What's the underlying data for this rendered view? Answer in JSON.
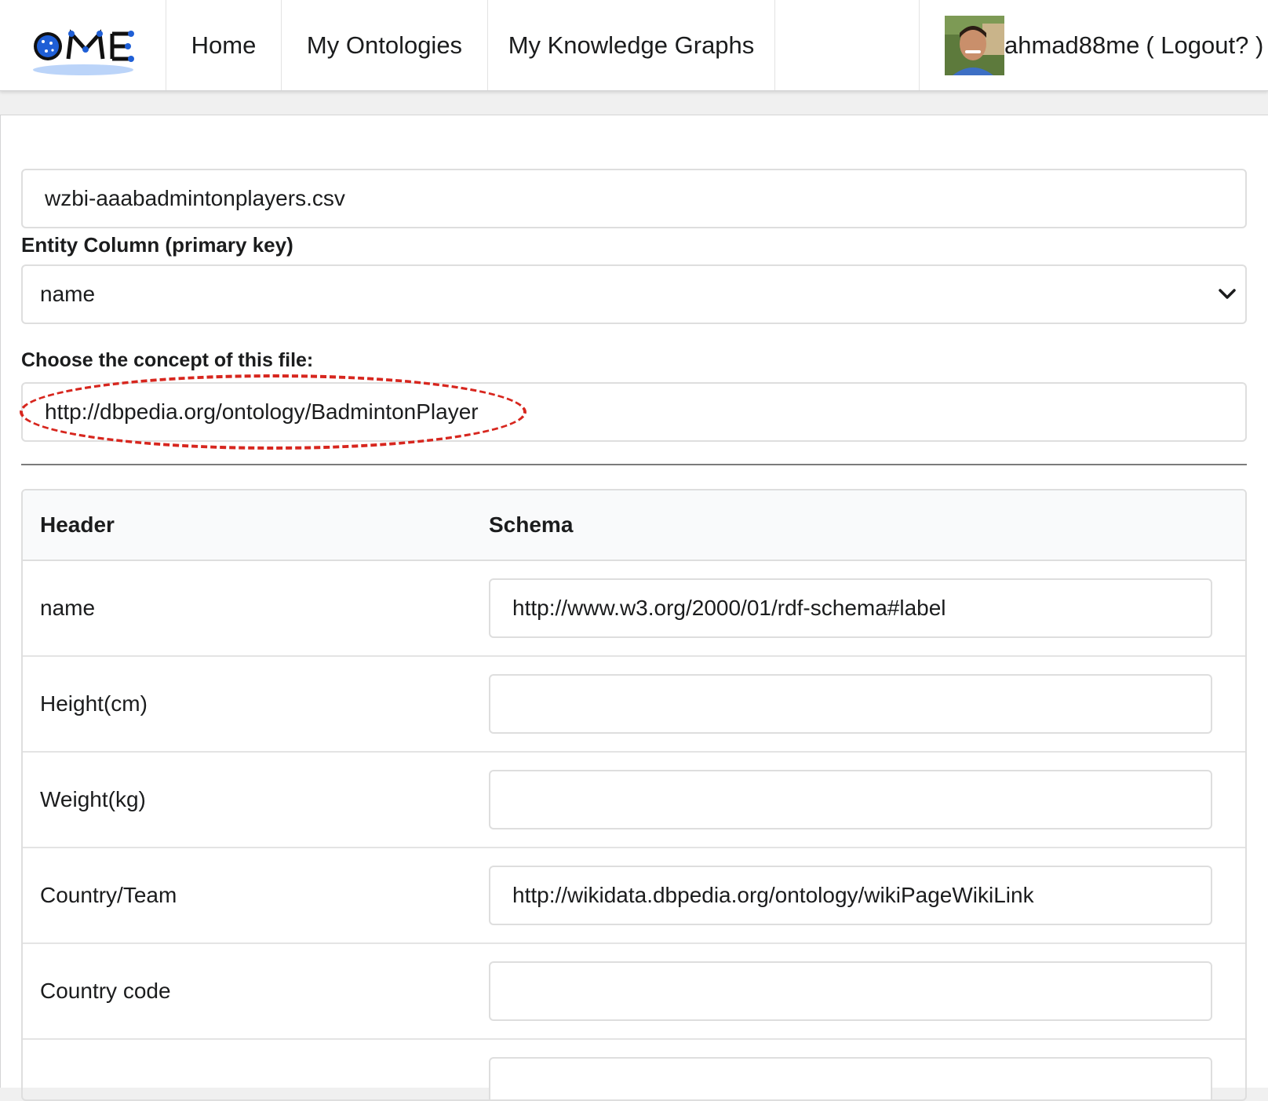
{
  "nav": {
    "home": "Home",
    "ontologies": "My Ontologies",
    "knowledge_graphs": "My Knowledge Graphs",
    "username": "ahmad88me",
    "logout": "( Logout? )"
  },
  "form": {
    "file_name": "wzbi-aaabadmintonplayers.csv",
    "entity_label": "Entity Column (primary key)",
    "entity_selected": "name",
    "concept_label": "Choose the concept of this file:",
    "concept_value": "http://dbpedia.org/ontology/BadmintonPlayer"
  },
  "table": {
    "col_header": "Header",
    "col_schema": "Schema",
    "rows": [
      {
        "header": "name",
        "schema": "http://www.w3.org/2000/01/rdf-schema#label"
      },
      {
        "header": "Height(cm)",
        "schema": ""
      },
      {
        "header": "Weight(kg)",
        "schema": ""
      },
      {
        "header": "Country/Team",
        "schema": "http://wikidata.dbpedia.org/ontology/wikiPageWikiLink"
      },
      {
        "header": "Country code",
        "schema": ""
      },
      {
        "header": "",
        "schema": ""
      }
    ]
  },
  "colors": {
    "highlight": "#d7261e",
    "logo_blue": "#1f5fd6"
  }
}
